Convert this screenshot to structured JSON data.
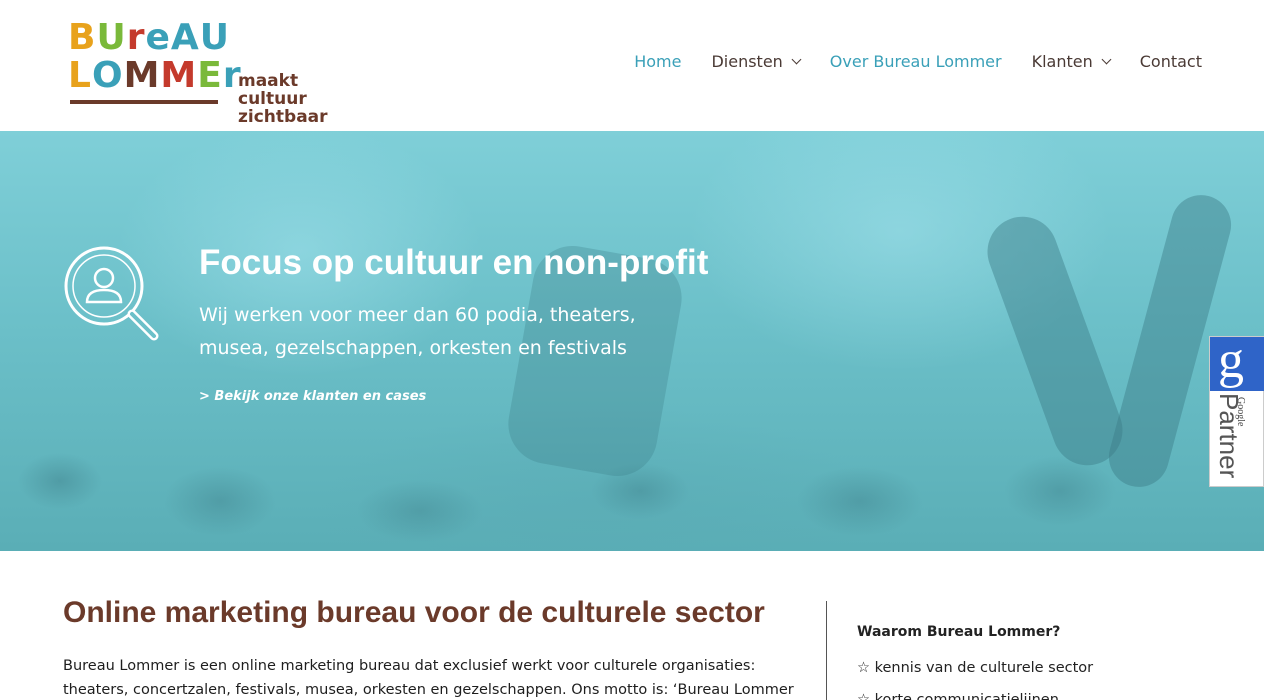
{
  "logo": {
    "line1": [
      {
        "ch": "B",
        "color": "#e8a21c"
      },
      {
        "ch": "U",
        "color": "#7ab93a"
      },
      {
        "ch": "r",
        "color": "#c43a2c"
      },
      {
        "ch": "e",
        "color": "#3aa0b8"
      },
      {
        "ch": "A",
        "color": "#3aa0b8"
      },
      {
        "ch": "U",
        "color": "#3aa0b8"
      }
    ],
    "line2": [
      {
        "ch": "L",
        "color": "#e8a21c"
      },
      {
        "ch": "O",
        "color": "#3aa0b8"
      },
      {
        "ch": "M",
        "color": "#6b3a2a"
      },
      {
        "ch": "M",
        "color": "#c43a2c"
      },
      {
        "ch": "E",
        "color": "#7ab93a"
      },
      {
        "ch": "r",
        "color": "#3aa0b8"
      }
    ],
    "tagline_1": "maakt cultuur",
    "tagline_2": "zichtbaar"
  },
  "nav": {
    "home": "Home",
    "diensten": "Diensten",
    "over": "Over Bureau Lommer",
    "klanten": "Klanten",
    "contact": "Contact"
  },
  "hero": {
    "title": "Focus op cultuur en non-profit",
    "subtitle": "Wij werken voor meer dan 60 podia, theaters, musea, gezelschappen, orkesten en festivals",
    "link": "> Bekijk onze klanten en cases",
    "icon": "search-person-icon"
  },
  "badge": {
    "letter": "g",
    "google": "Google",
    "partner": "Partner"
  },
  "content": {
    "title": "Online marketing bureau voor de culturele sector",
    "text": "Bureau Lommer is een online marketing bureau dat exclusief werkt voor culturele organisaties: theaters, concertzalen, festivals, musea, orkesten en gezelschappen. Ons motto is: ‘Bureau Lommer"
  },
  "sidebar": {
    "title": "Waarom Bureau Lommer?",
    "items": [
      "☆ kennis van de culturele sector",
      "☆ korte communicatielijnen"
    ]
  },
  "colors": {
    "brand_brown": "#6b3a2a",
    "accent_teal": "#3aa0b8",
    "google_blue": "#2f64c8"
  }
}
